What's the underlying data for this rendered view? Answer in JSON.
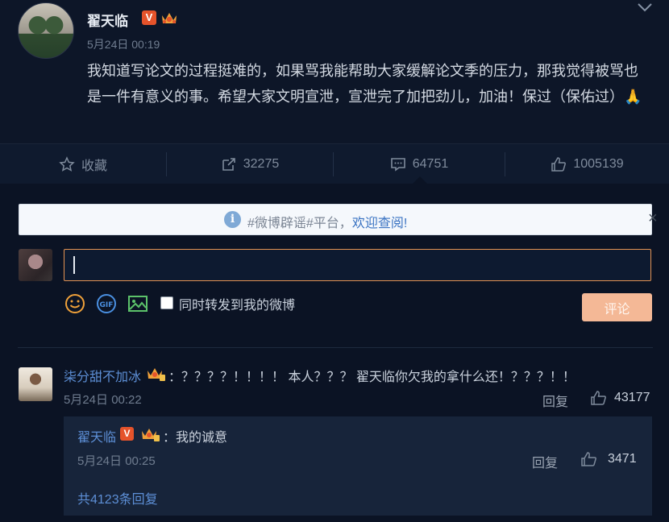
{
  "post": {
    "author": "翟天临",
    "verified_badge": "V",
    "time": "5月24日 00:19",
    "text": "我知道写论文的过程挺难的，如果骂我能帮助大家缓解论文季的压力，那我觉得被骂也是一件有意义的事。希望大家文明宣泄，宣泄完了加把劲儿，加油！保过（保佑过）🙏"
  },
  "actions": {
    "favorite": "收藏",
    "reposts": "32275",
    "comments": "64751",
    "likes": "1005139"
  },
  "notice": {
    "prefix": "#微博辟谣#平台，",
    "link": "欢迎查阅!",
    "close": "×"
  },
  "composer": {
    "value": "",
    "also_repost_label": "同时转发到我的微博",
    "submit_label": "评论",
    "gif_label": "GIF"
  },
  "comments": [
    {
      "user": "柒分甜不加冰",
      "text": "：？？？？！！！！ 本人？？？ 翟天临你欠我的拿什么还！？？？！！",
      "time": "5月24日 00:22",
      "reply_label": "回复",
      "likes": "43177",
      "sub_reply": {
        "user": "翟天临",
        "verified_badge": "V",
        "text": "：我的诚意",
        "time": "5月24日 00:25",
        "reply_label": "回复",
        "likes": "3471"
      },
      "more_replies": "共4123条回复"
    }
  ],
  "colors": {
    "background": "#0b1324",
    "link": "#5d8fd6",
    "accent": "#e49352",
    "submit": "#f4b896",
    "vbadge": "#e5532b"
  }
}
